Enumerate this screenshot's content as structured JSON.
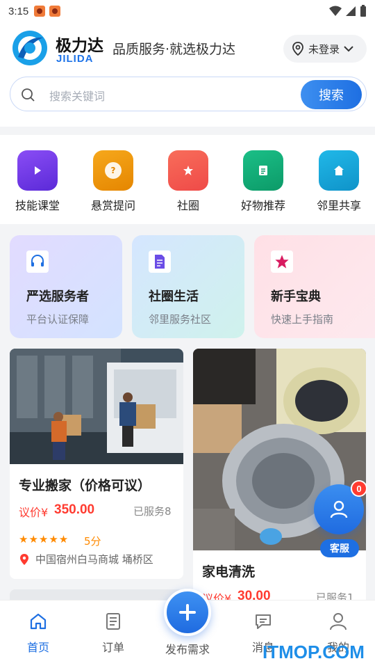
{
  "status": {
    "time": "3:15"
  },
  "header": {
    "brand_cn": "极力达",
    "brand_en": "JILIDA",
    "slogan": "品质服务·就选极力达",
    "login": "未登录"
  },
  "search": {
    "placeholder": "搜索关键词",
    "button": "搜索"
  },
  "quick_menu": [
    {
      "label": "技能课堂",
      "icon": "play-icon",
      "color": "#7a3cf0"
    },
    {
      "label": "悬赏提问",
      "icon": "question-icon",
      "color": "#f29a0b"
    },
    {
      "label": "社圈",
      "icon": "star-icon",
      "color": "#f55a4e"
    },
    {
      "label": "好物推荐",
      "icon": "document-icon",
      "color": "#13b07a"
    },
    {
      "label": "邻里共享",
      "icon": "home-icon",
      "color": "#17a7d8"
    }
  ],
  "features": [
    {
      "title": "严选服务者",
      "subtitle": "平台认证保障",
      "icon": "headset-icon"
    },
    {
      "title": "社圈生活",
      "subtitle": "邻里服务社区",
      "icon": "document-icon"
    },
    {
      "title": "新手宝典",
      "subtitle": "快速上手指南",
      "icon": "star-icon"
    }
  ],
  "products": [
    {
      "title": "专业搬家（价格可议）",
      "price_label": "议价¥",
      "price": "350.00",
      "served": "已服务8",
      "stars": "★★★★★",
      "score": "5分",
      "location": "中国宿州白马商城 埇桥区"
    },
    {
      "title": "家电清洗",
      "price_label": "议价¥",
      "price": "30.00",
      "served": "已服务1"
    }
  ],
  "customer_service": {
    "badge": "0",
    "label": "客服"
  },
  "nav": {
    "home": "首页",
    "orders": "订单",
    "publish": "发布需求",
    "messages": "消息",
    "mine": "我的"
  },
  "watermark": "ITMOP.COM",
  "colors": {
    "primary": "#1e6fe2",
    "price": "#ff3b30"
  }
}
